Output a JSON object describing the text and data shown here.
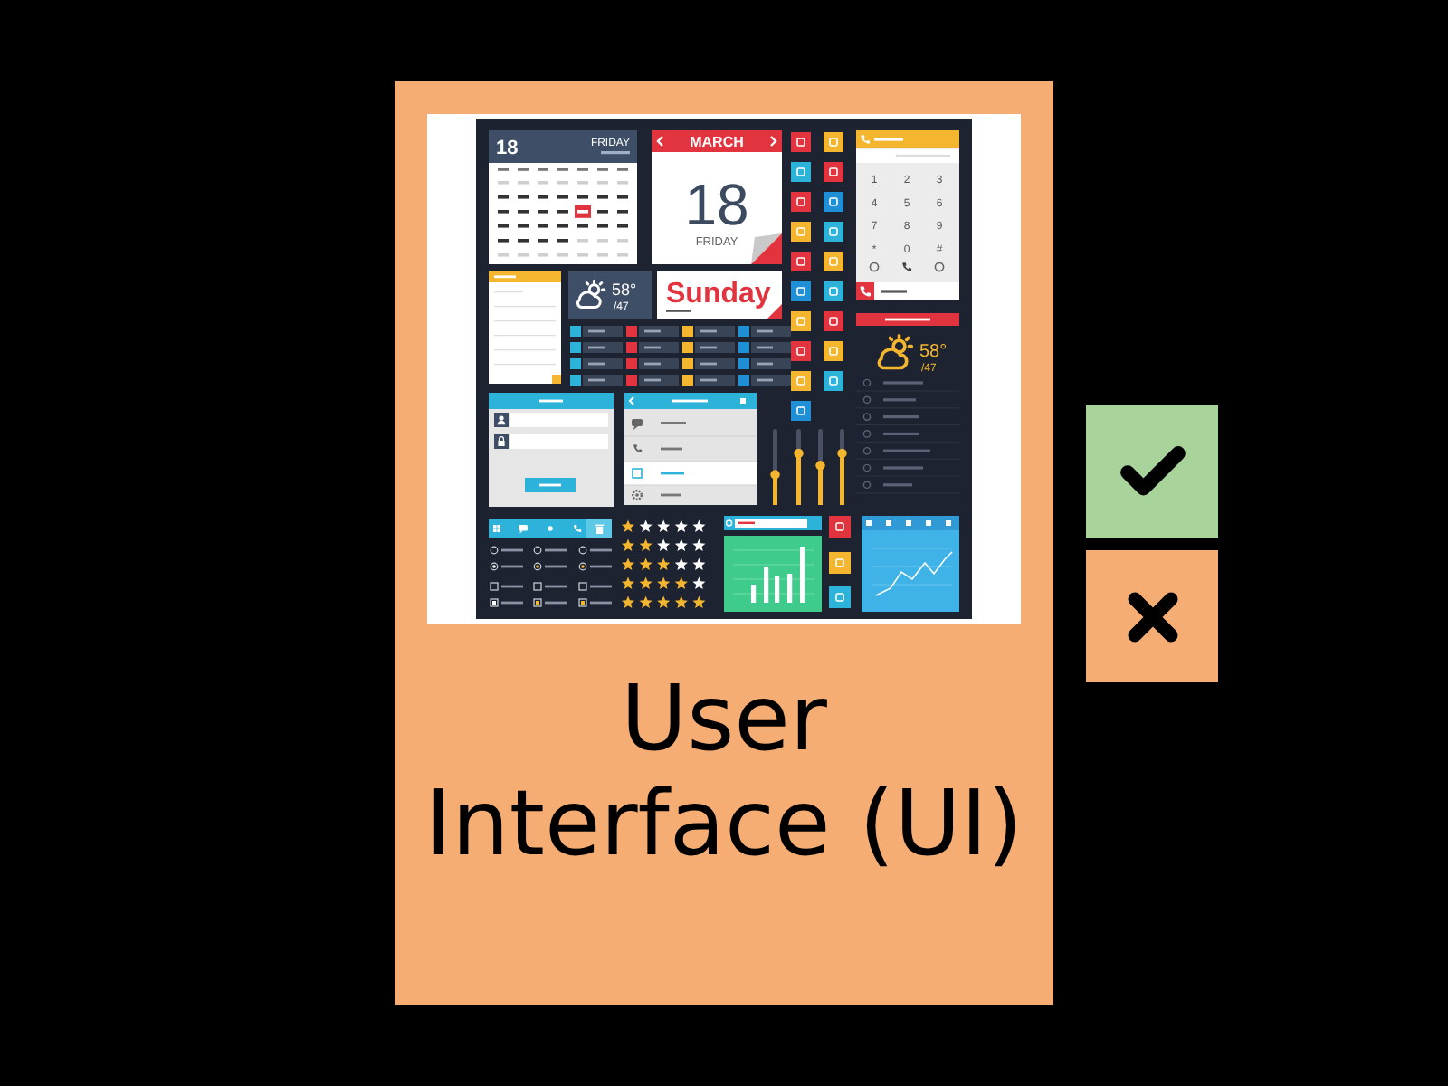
{
  "card": {
    "image": {
      "kind": "ui-kit",
      "calendar": {
        "day": "18",
        "weekday": "FRIDAY"
      },
      "date_card": {
        "month": "MARCH",
        "day": "18",
        "weekday": "FRIDAY"
      },
      "weather_tile": {
        "temperature": "58°",
        "low": "/47"
      },
      "day_card": {
        "day": "Sunday"
      },
      "keypad": {
        "keys": [
          "1",
          "2",
          "3",
          "4",
          "5",
          "6",
          "7",
          "8",
          "9",
          "*",
          "0",
          "#"
        ]
      },
      "weather_widget": {
        "temperature": "58°",
        "low": "/47"
      },
      "sliders": [
        {
          "level": 0.4
        },
        {
          "level": 0.68
        },
        {
          "level": 0.52
        },
        {
          "level": 0.68
        }
      ],
      "options": [
        {
          "kind": "radio",
          "checked": false
        },
        {
          "kind": "radio",
          "checked": true
        },
        {
          "kind": "checkbox",
          "checked": false
        },
        {
          "kind": "checkbox",
          "checked": true
        }
      ],
      "ratings": [
        {
          "stars": 1
        },
        {
          "stars": 2
        },
        {
          "stars": 3
        },
        {
          "stars": 4
        },
        {
          "stars": 5
        }
      ]
    },
    "caption": "User Interface (UI)"
  },
  "buttons": [
    {
      "kind": "correct"
    },
    {
      "kind": "wrong"
    }
  ]
}
